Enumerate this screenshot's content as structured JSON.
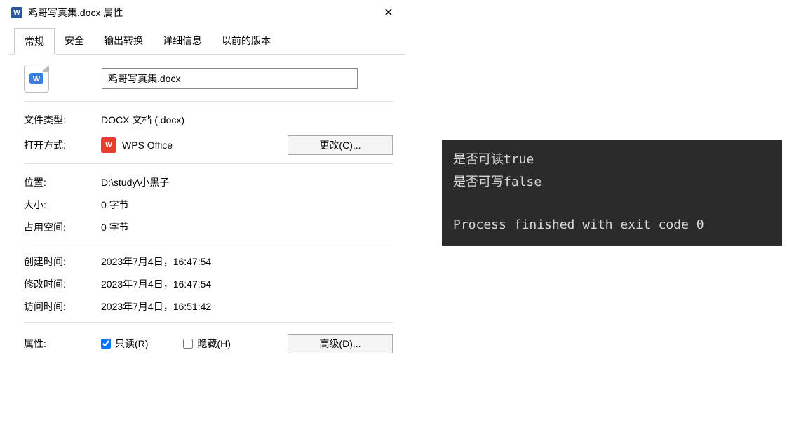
{
  "window": {
    "title": "鸡哥写真集.docx 属性"
  },
  "tabs": [
    "常规",
    "安全",
    "输出转换",
    "详细信息",
    "以前的版本"
  ],
  "file": {
    "name": "鸡哥写真集.docx"
  },
  "fields": {
    "type_label": "文件类型:",
    "type_value": "DOCX 文档 (.docx)",
    "open_with_label": "打开方式:",
    "open_with_app": "WPS Office",
    "change_button": "更改(C)...",
    "location_label": "位置:",
    "location_value": "D:\\study\\小黑子",
    "size_label": "大小:",
    "size_value": "0 字节",
    "disk_label": "占用空间:",
    "disk_value": "0 字节",
    "created_label": "创建时间:",
    "created_value": "2023年7月4日，16:47:54",
    "modified_label": "修改时间:",
    "modified_value": "2023年7月4日，16:47:54",
    "accessed_label": "访问时间:",
    "accessed_value": "2023年7月4日，16:51:42",
    "attrs_label": "属性:",
    "readonly_label": "只读(R)",
    "hidden_label": "隐藏(H)",
    "advanced_button": "高级(D)..."
  },
  "console": {
    "line1_prefix": "是否可读",
    "line1_value": "true",
    "line2_prefix": "是否可写",
    "line2_value": "false",
    "line3": "Process finished with exit code 0"
  }
}
